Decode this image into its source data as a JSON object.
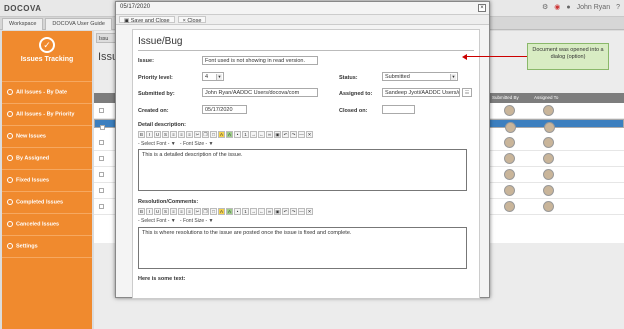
{
  "app": {
    "logo": "DOCOVA",
    "user": "John Ryan"
  },
  "tabs": [
    "Workspace",
    "DOCOVA User Guide"
  ],
  "sidebar": {
    "title": "Issues Tracking",
    "items": [
      {
        "label": "All Issues - By Date"
      },
      {
        "label": "All Issues - By Priority"
      },
      {
        "label": "New Issues"
      },
      {
        "label": "By Assigned"
      },
      {
        "label": "Fixed Issues"
      },
      {
        "label": "Completed Issues"
      },
      {
        "label": "Canceled Issues"
      },
      {
        "label": "Settings"
      }
    ]
  },
  "background": {
    "tab": "Issu",
    "title": "Issu",
    "columns": [
      "Submitted By",
      "Assigned To"
    ]
  },
  "modal": {
    "date": "05/17/2020",
    "buttons": {
      "save_close": "Save and Close",
      "close": "Close"
    },
    "doc_title": "Issue/Bug",
    "issue_label": "Issue:",
    "issue_value": "Font used is not showing in read version.",
    "priority_label": "Priority level:",
    "priority_value": "4",
    "status_label": "Status:",
    "status_value": "Submitted",
    "submitted_label": "Submitted by:",
    "submitted_value": "John Ryan/AADDC Users/docova/com",
    "assigned_label": "Assigned to:",
    "assigned_value": "Sandeep Jyoti/AADDC Users/do",
    "created_label": "Created on:",
    "created_value": "05/17/2020",
    "closed_label": "Closed on:",
    "closed_value": "",
    "detail_label": "Detail description:",
    "font_select": "- Select Font -",
    "size_select": "- Font Size -",
    "detail_text": "This is a detailed description of the issue.",
    "resolution_label": "Resolution/Comments:",
    "resolution_text": "This is where resolutions to the issue are posted once the issue is fixed and complete.",
    "more_label": "Here is some text:"
  },
  "callout": {
    "text": "Document was opened into a dialog (option)"
  },
  "colors": {
    "sidebar": "#f08a2e",
    "selected_row": "#3c7fbf",
    "callout_bg": "#d8ecc3",
    "arrow": "#cc0000"
  }
}
